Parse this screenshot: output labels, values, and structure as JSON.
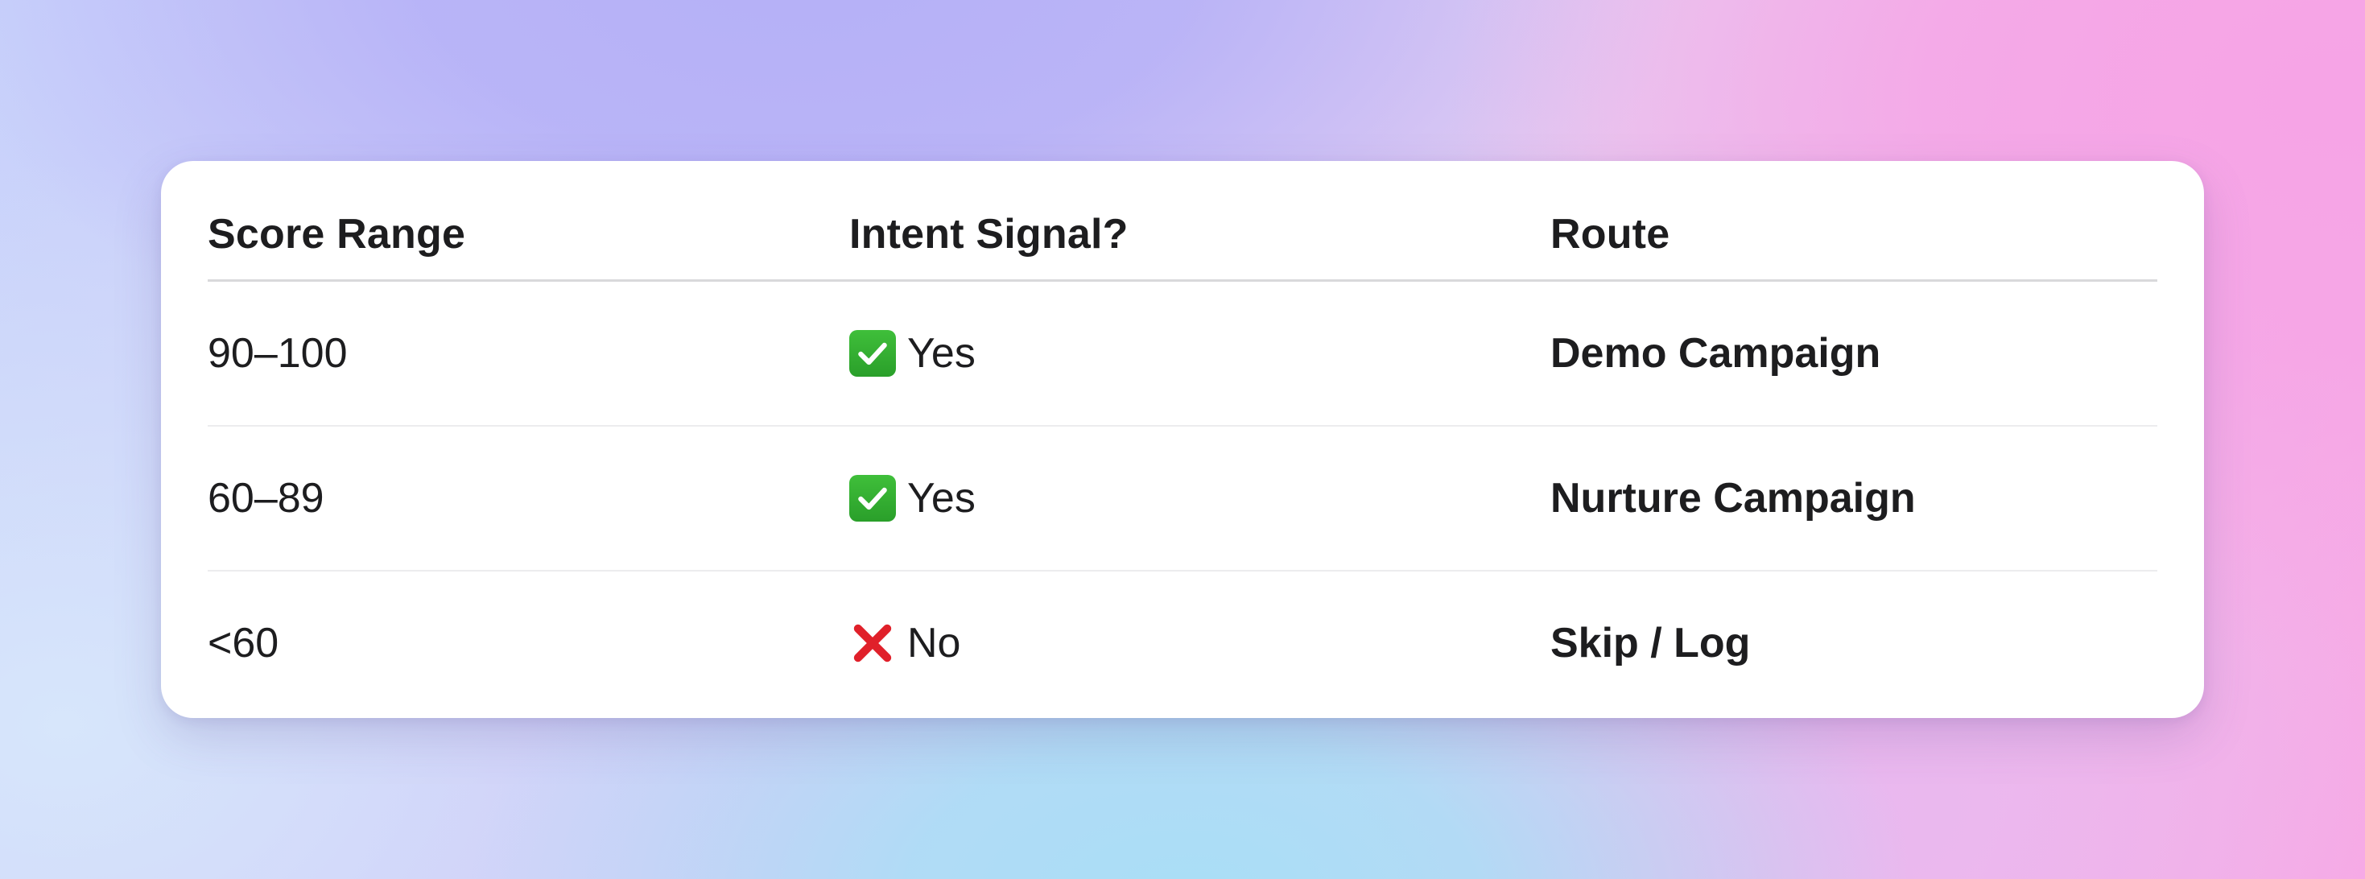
{
  "table": {
    "headers": {
      "score_range": "Score Range",
      "intent_signal": "Intent Signal?",
      "route": "Route"
    },
    "rows": [
      {
        "score_range": "90–100",
        "intent_icon": "check-mark-icon",
        "intent_text": "Yes",
        "route": "Demo Campaign"
      },
      {
        "score_range": "60–89",
        "intent_icon": "check-mark-icon",
        "intent_text": "Yes",
        "route": "Nurture Campaign"
      },
      {
        "score_range": "<60",
        "intent_icon": "cross-mark-icon",
        "intent_text": "No",
        "route": "Skip / Log"
      }
    ]
  },
  "colors": {
    "check_green": "#34b233",
    "cross_red": "#e0202a",
    "text": "#1d1d1f"
  }
}
